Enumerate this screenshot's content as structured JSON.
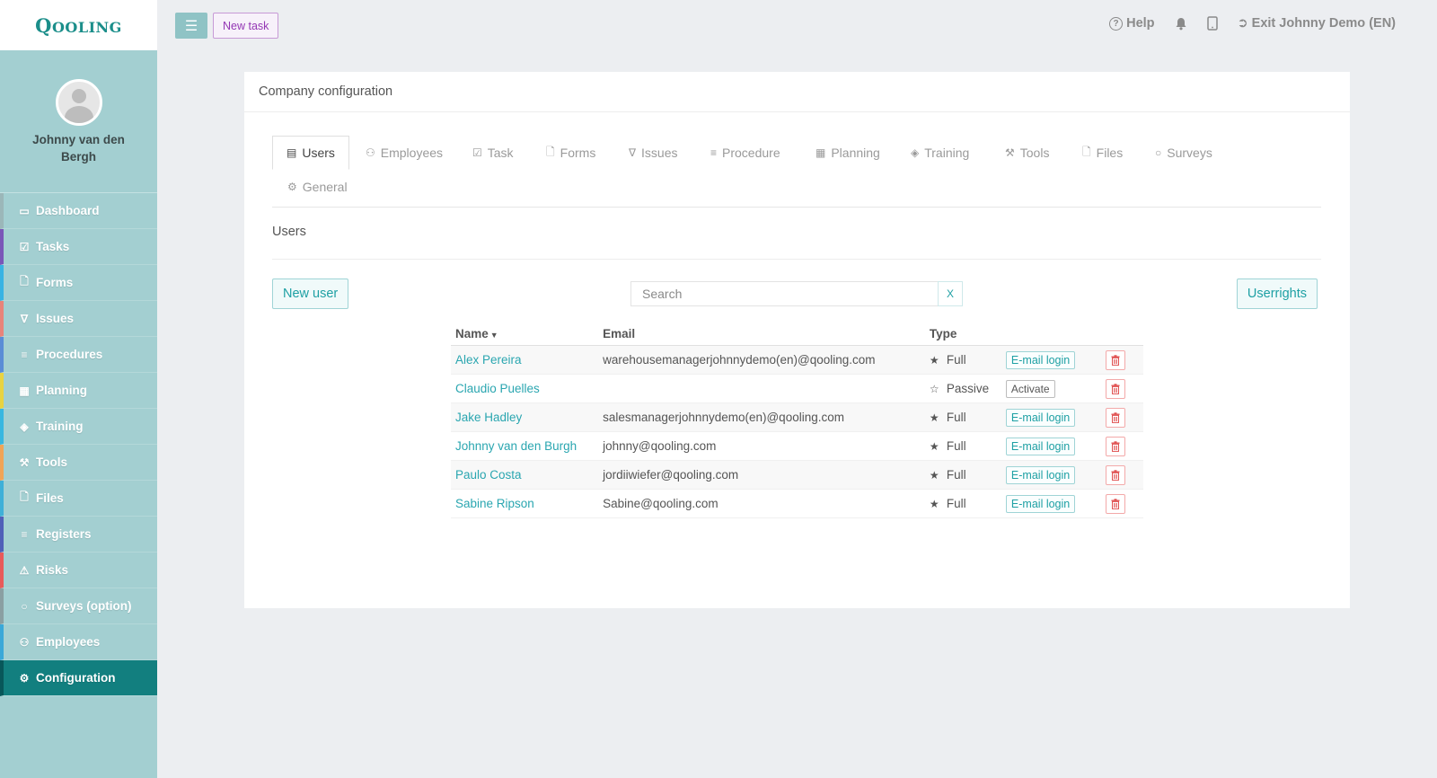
{
  "brand": {
    "logo_text": "Qooling"
  },
  "profile": {
    "name": "Johnny van den Bergh"
  },
  "nav": [
    {
      "label": "Dashboard",
      "icon": "desktop-icon",
      "accent": "#9bb7b9"
    },
    {
      "label": "Tasks",
      "icon": "check-square-icon",
      "accent": "#7a56b8"
    },
    {
      "label": "Forms",
      "icon": "file-icon",
      "accent": "#39b3e3"
    },
    {
      "label": "Issues",
      "icon": "bell-icon",
      "accent": "#e8847a"
    },
    {
      "label": "Procedures",
      "icon": "list-icon",
      "accent": "#5a8dd6"
    },
    {
      "label": "Planning",
      "icon": "calendar-icon",
      "accent": "#e8d341"
    },
    {
      "label": "Training",
      "icon": "graduation-cap-icon",
      "accent": "#38b7e0"
    },
    {
      "label": "Tools",
      "icon": "wrench-icon",
      "accent": "#f0a457"
    },
    {
      "label": "Files",
      "icon": "file-icon",
      "accent": "#3fb0d8"
    },
    {
      "label": "Registers",
      "icon": "list-icon",
      "accent": "#5060b8"
    },
    {
      "label": "Risks",
      "icon": "warning-icon",
      "accent": "#e85a5a"
    },
    {
      "label": "Surveys (option)",
      "icon": "comment-icon",
      "accent": "#8a9fa2"
    },
    {
      "label": "Employees",
      "icon": "users-icon",
      "accent": "#3aa8d8"
    },
    {
      "label": "Configuration",
      "icon": "gear-icon",
      "accent": "#08575a",
      "active": true
    }
  ],
  "topbar": {
    "new_task_label": "New task",
    "help_label": "Help",
    "exit_label": "Exit Johnny Demo (EN)"
  },
  "card": {
    "title": "Company configuration"
  },
  "tabs": [
    {
      "label": "Users",
      "icon": "id-card-icon",
      "active": true
    },
    {
      "label": "Employees",
      "icon": "users-icon"
    },
    {
      "label": "Task",
      "icon": "check-square-icon"
    },
    {
      "label": "Forms",
      "icon": "file-icon"
    },
    {
      "label": "Issues",
      "icon": "bell-icon"
    },
    {
      "label": "Procedure",
      "icon": "list-icon"
    },
    {
      "label": "Planning",
      "icon": "calendar-icon"
    },
    {
      "label": "Training",
      "icon": "graduation-cap-icon"
    },
    {
      "label": "Tools",
      "icon": "wrench-icon"
    },
    {
      "label": "Files",
      "icon": "file-icon"
    },
    {
      "label": "Surveys",
      "icon": "comment-icon"
    },
    {
      "label": "General",
      "icon": "gear-icon"
    }
  ],
  "section": {
    "title": "Users"
  },
  "actions": {
    "new_user_label": "New user",
    "search_placeholder": "Search",
    "search_clear_label": "X",
    "userrights_label": "Userrights"
  },
  "table": {
    "columns": {
      "name": "Name",
      "email": "Email",
      "type": "Type"
    },
    "rows": [
      {
        "name": "Alex Pereira",
        "email": "warehousemanagerjohnnydemo(en)@qooling.com",
        "type": "Full",
        "action": "E-mail login"
      },
      {
        "name": "Claudio Puelles",
        "email": "",
        "type": "Passive",
        "action": "Activate"
      },
      {
        "name": "Jake Hadley",
        "email": "salesmanagerjohnnydemo(en)@qooling.com",
        "type": "Full",
        "action": "E-mail login"
      },
      {
        "name": "Johnny van den Burgh",
        "email": "johnny@qooling.com",
        "type": "Full",
        "action": "E-mail login"
      },
      {
        "name": "Paulo Costa",
        "email": "jordiiwiefer@qooling.com",
        "type": "Full",
        "action": "E-mail login"
      },
      {
        "name": "Sabine Ripson",
        "email": "Sabine@qooling.com",
        "type": "Full",
        "action": "E-mail login"
      }
    ]
  },
  "colors": {
    "sidebar_bg": "#a3cfd1",
    "active_nav_bg": "#127f7f",
    "link": "#2aa6b0",
    "delete_red": "#e05050"
  }
}
